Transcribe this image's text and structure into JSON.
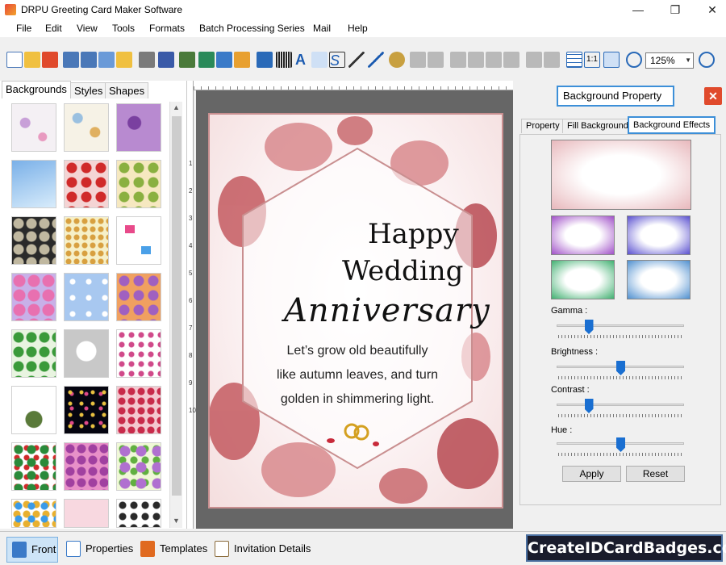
{
  "window": {
    "title": "DRPU Greeting Card Maker Software"
  },
  "menu": [
    "File",
    "Edit",
    "View",
    "Tools",
    "Formats",
    "Batch Processing Series",
    "Mail",
    "Help"
  ],
  "toolbar": {
    "zoom": "125%"
  },
  "left_panel": {
    "tabs": [
      "Backgrounds",
      "Styles",
      "Shapes"
    ]
  },
  "ruler": {
    "vertical_numbers": [
      "1",
      "2",
      "3",
      "4",
      "5",
      "6",
      "7",
      "8",
      "9",
      "10"
    ]
  },
  "card": {
    "line1": "Happy",
    "line2": "Wedding",
    "line3": "Anniversary",
    "message": [
      "Let’s grow old beautifully",
      "like autumn leaves, and turn",
      "golden in shimmering light."
    ]
  },
  "right_panel": {
    "title": "Background Property",
    "close_icon": "close-icon",
    "tabs": [
      "Property",
      "Fill Background",
      "Background Effects"
    ],
    "sliders": [
      {
        "label": "Gamma :",
        "level": 0.25
      },
      {
        "label": "Brightness :",
        "level": 0.5
      },
      {
        "label": "Contrast :",
        "level": 0.25
      },
      {
        "label": "Hue :",
        "level": 0.5
      }
    ],
    "apply_label": "Apply",
    "reset_label": "Reset"
  },
  "bottom_tabs": [
    "Front",
    "Properties",
    "Templates",
    "Invitation Details"
  ],
  "brand": "CreateIDCardBadges.com",
  "colors": {
    "accent": "#3c8fd8",
    "close": "#e04a2c",
    "canvas": "#666666",
    "floral": "#c96a6f"
  }
}
